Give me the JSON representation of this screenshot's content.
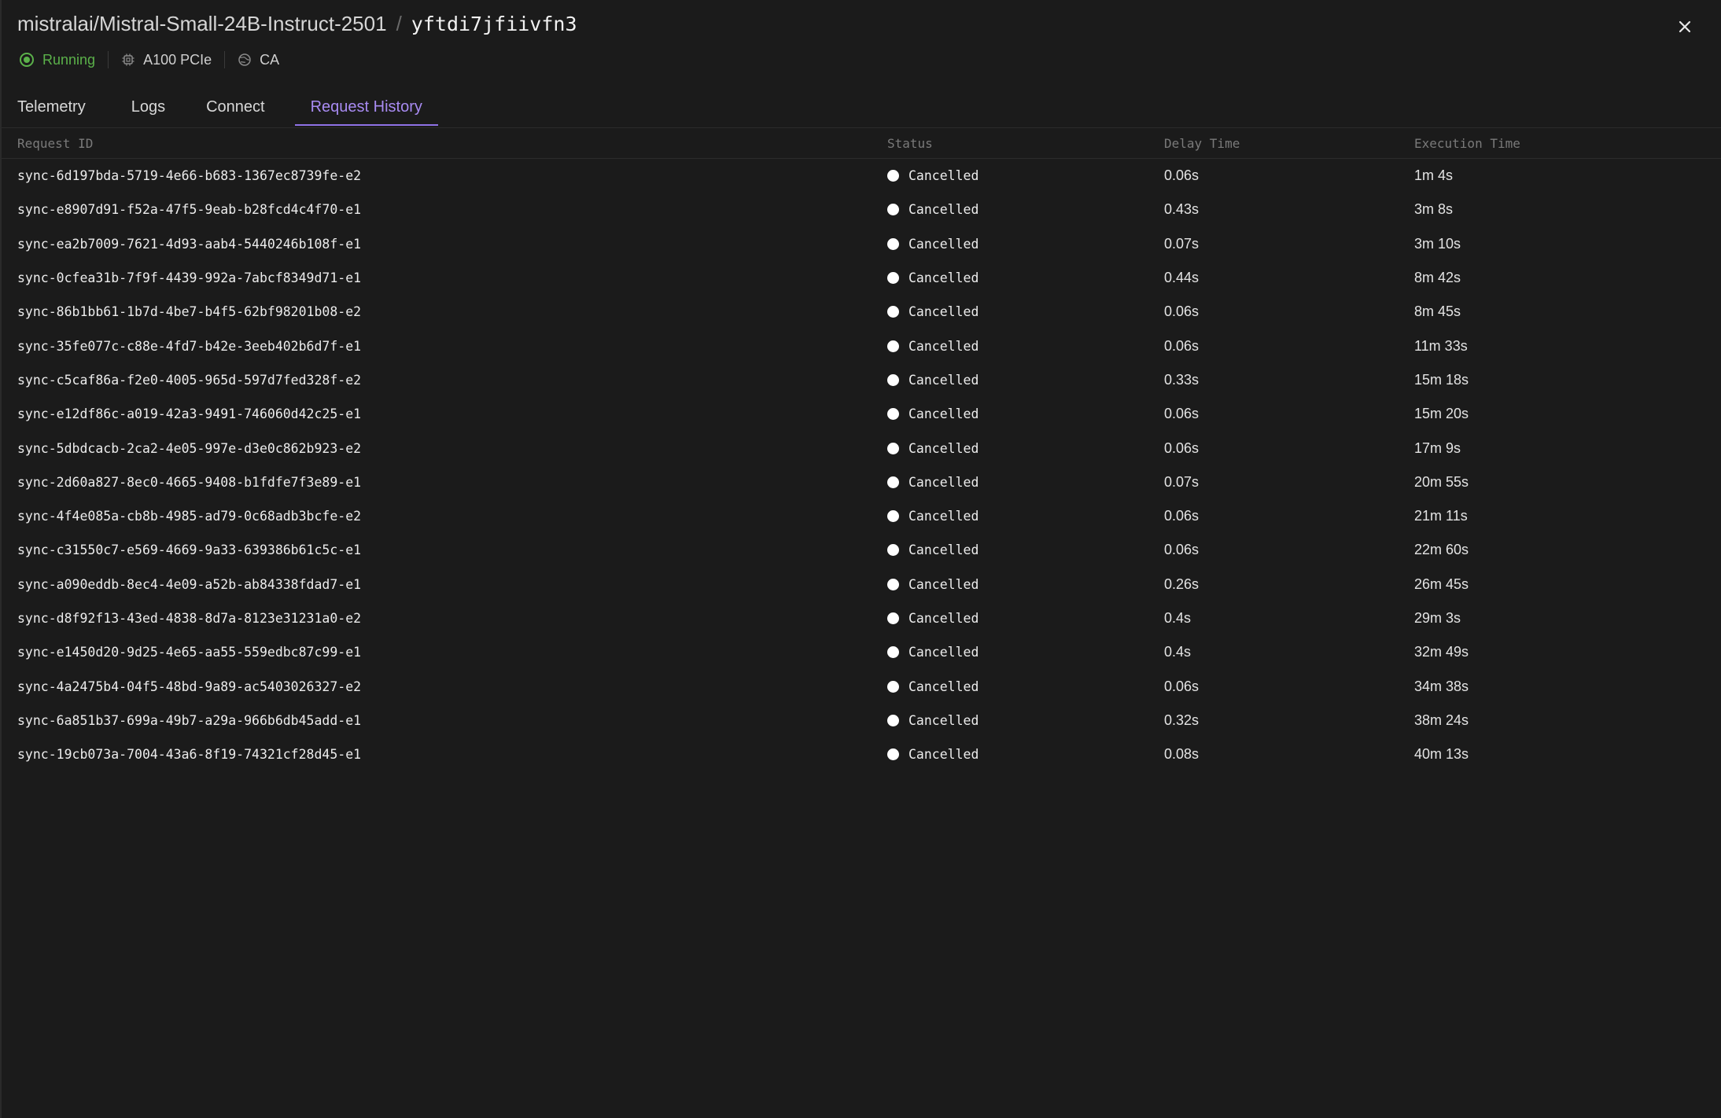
{
  "header": {
    "model_name": "mistralai/Mistral-Small-24B-Instruct-2501",
    "separator": "/",
    "endpoint_id": "yftdi7jfiivfn3",
    "status": "Running",
    "gpu": "A100 PCIe",
    "region": "CA"
  },
  "tabs": [
    {
      "label": "Telemetry",
      "active": false
    },
    {
      "label": "Logs",
      "active": false
    },
    {
      "label": "Connect",
      "active": false
    },
    {
      "label": "Request History",
      "active": true
    }
  ],
  "table": {
    "columns": {
      "request_id": "Request ID",
      "status": "Status",
      "delay_time": "Delay Time",
      "execution_time": "Execution Time"
    },
    "rows": [
      {
        "id": "sync-6d197bda-5719-4e66-b683-1367ec8739fe-e2",
        "status": "Cancelled",
        "delay": "0.06s",
        "exec": "1m 4s"
      },
      {
        "id": "sync-e8907d91-f52a-47f5-9eab-b28fcd4c4f70-e1",
        "status": "Cancelled",
        "delay": "0.43s",
        "exec": "3m 8s"
      },
      {
        "id": "sync-ea2b7009-7621-4d93-aab4-5440246b108f-e1",
        "status": "Cancelled",
        "delay": "0.07s",
        "exec": "3m 10s"
      },
      {
        "id": "sync-0cfea31b-7f9f-4439-992a-7abcf8349d71-e1",
        "status": "Cancelled",
        "delay": "0.44s",
        "exec": "8m 42s"
      },
      {
        "id": "sync-86b1bb61-1b7d-4be7-b4f5-62bf98201b08-e2",
        "status": "Cancelled",
        "delay": "0.06s",
        "exec": "8m 45s"
      },
      {
        "id": "sync-35fe077c-c88e-4fd7-b42e-3eeb402b6d7f-e1",
        "status": "Cancelled",
        "delay": "0.06s",
        "exec": "11m 33s"
      },
      {
        "id": "sync-c5caf86a-f2e0-4005-965d-597d7fed328f-e2",
        "status": "Cancelled",
        "delay": "0.33s",
        "exec": "15m 18s"
      },
      {
        "id": "sync-e12df86c-a019-42a3-9491-746060d42c25-e1",
        "status": "Cancelled",
        "delay": "0.06s",
        "exec": "15m 20s"
      },
      {
        "id": "sync-5dbdcacb-2ca2-4e05-997e-d3e0c862b923-e2",
        "status": "Cancelled",
        "delay": "0.06s",
        "exec": "17m 9s"
      },
      {
        "id": "sync-2d60a827-8ec0-4665-9408-b1fdfe7f3e89-e1",
        "status": "Cancelled",
        "delay": "0.07s",
        "exec": "20m 55s"
      },
      {
        "id": "sync-4f4e085a-cb8b-4985-ad79-0c68adb3bcfe-e2",
        "status": "Cancelled",
        "delay": "0.06s",
        "exec": "21m 11s"
      },
      {
        "id": "sync-c31550c7-e569-4669-9a33-639386b61c5c-e1",
        "status": "Cancelled",
        "delay": "0.06s",
        "exec": "22m 60s"
      },
      {
        "id": "sync-a090eddb-8ec4-4e09-a52b-ab84338fdad7-e1",
        "status": "Cancelled",
        "delay": "0.26s",
        "exec": "26m 45s"
      },
      {
        "id": "sync-d8f92f13-43ed-4838-8d7a-8123e31231a0-e2",
        "status": "Cancelled",
        "delay": "0.4s",
        "exec": "29m 3s"
      },
      {
        "id": "sync-e1450d20-9d25-4e65-aa55-559edbc87c99-e1",
        "status": "Cancelled",
        "delay": "0.4s",
        "exec": "32m 49s"
      },
      {
        "id": "sync-4a2475b4-04f5-48bd-9a89-ac5403026327-e2",
        "status": "Cancelled",
        "delay": "0.06s",
        "exec": "34m 38s"
      },
      {
        "id": "sync-6a851b37-699a-49b7-a29a-966b6db45add-e1",
        "status": "Cancelled",
        "delay": "0.32s",
        "exec": "38m 24s"
      },
      {
        "id": "sync-19cb073a-7004-43a6-8f19-74321cf28d45-e1",
        "status": "Cancelled",
        "delay": "0.08s",
        "exec": "40m 13s"
      }
    ]
  },
  "colors": {
    "background": "#1b1b1b",
    "accent": "#a88bf2",
    "running": "#5bb14a",
    "cancelled_dot": "#ffffff"
  },
  "icons": {
    "status": "running-circle-icon",
    "gpu": "chip-icon",
    "region": "globe-icon",
    "close": "close-icon",
    "row_status": "status-dot-icon"
  }
}
